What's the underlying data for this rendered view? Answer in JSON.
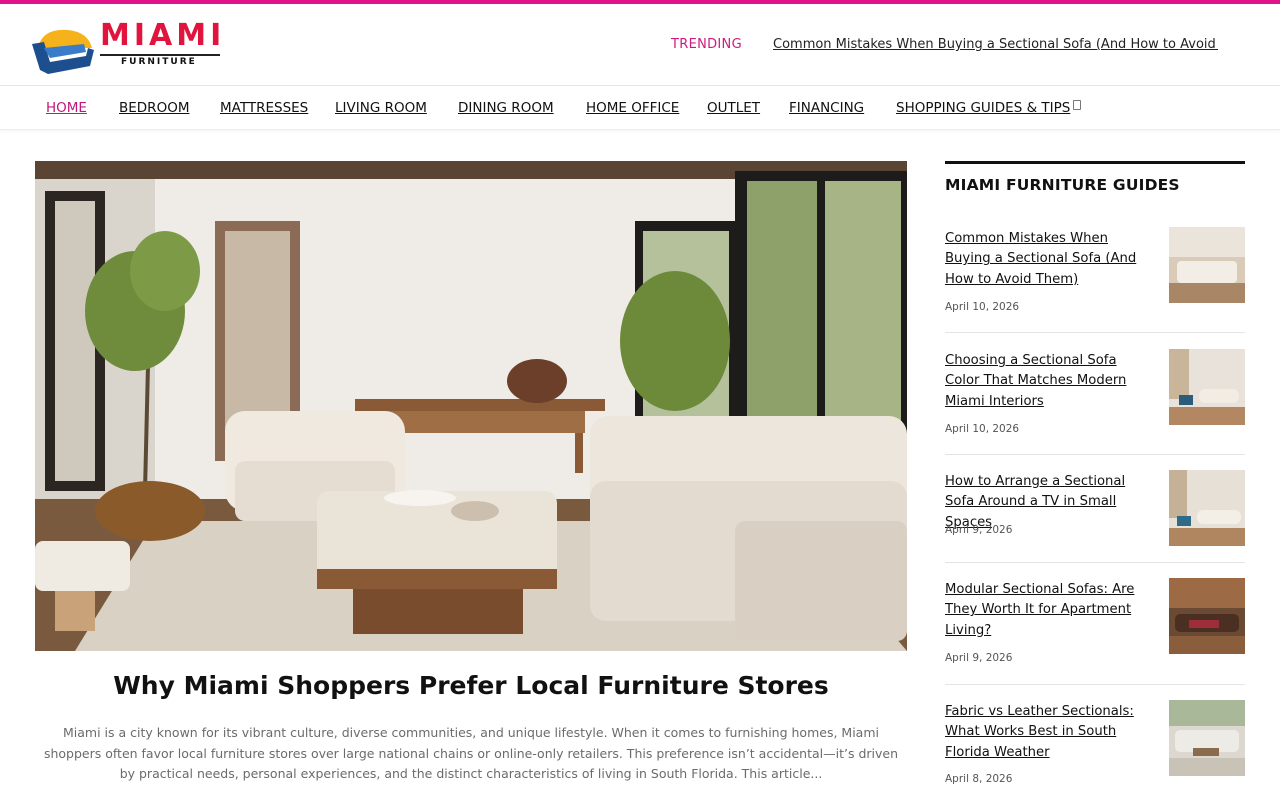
{
  "brand": {
    "name": "MIAMI",
    "tagline": "FURNITURE",
    "colors": {
      "accent": "#e0148a",
      "logo_red": "#e0143c",
      "logo_blue": "#1d4f8f",
      "logo_yellow": "#f5b21b"
    }
  },
  "header": {
    "trending_label": "TRENDING",
    "trending_text": "Common Mistakes When Buying a Sectional Sofa (And How to Avoid ..."
  },
  "nav": {
    "items": [
      {
        "label": "HOME",
        "active": true
      },
      {
        "label": "BEDROOM"
      },
      {
        "label": "MATTRESSES"
      },
      {
        "label": "LIVING ROOM"
      },
      {
        "label": "DINING ROOM"
      },
      {
        "label": "HOME OFFICE"
      },
      {
        "label": "OUTLET"
      },
      {
        "label": "FINANCING"
      },
      {
        "label": "SHOPPING GUIDES & TIPS"
      }
    ],
    "dropdown_icon": "chevron-down-icon"
  },
  "main": {
    "featured": {
      "image_description": "living room with cream sectional sofa, tufted ottoman, plants and large windows",
      "title": "Why Miami Shoppers Prefer Local Furniture Stores",
      "excerpt": "Miami is a city known for its vibrant culture, diverse communities, and unique lifestyle. When it comes to furnishing homes, Miami shoppers often favor local furniture stores over large national chains or online-only retailers. This preference isn’t accidental—it’s driven by practical needs, personal experiences, and the distinct characteristics of living in South Florida. This article..."
    }
  },
  "sidebar": {
    "heading": "MIAMI FURNITURE GUIDES",
    "posts": [
      {
        "title": "Common Mistakes When Buying a Sectional Sofa (And How to Avoid Them)",
        "date": "April 10, 2026"
      },
      {
        "title": "Choosing a Sectional Sofa Color That Matches Modern Miami Interiors",
        "date": "April 10, 2026"
      },
      {
        "title": "How to Arrange a Sectional Sofa Around a TV in Small Spaces",
        "date": "April 9, 2026"
      },
      {
        "title": "Modular Sectional Sofas: Are They Worth It for Apartment Living?",
        "date": "April 9, 2026"
      },
      {
        "title": "Fabric vs Leather Sectionals: What Works Best in South Florida Weather",
        "date": "April 8, 2026"
      }
    ]
  }
}
